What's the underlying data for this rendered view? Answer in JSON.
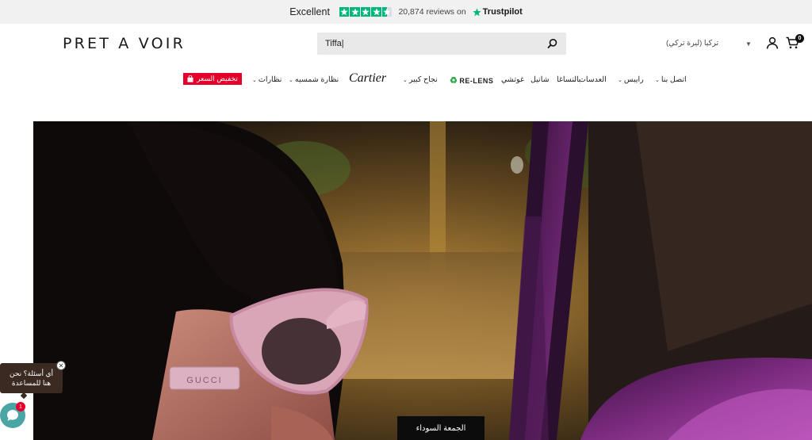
{
  "trustpilot": {
    "rating_text": "Excellent",
    "reviews": "20,874 reviews on",
    "brand": "Trustpilot",
    "star_color": "#00b67a",
    "rating_stars": 4.5
  },
  "header": {
    "logo": "PRET A VOIR",
    "search_value": "Tiffa|",
    "currency": "تركيا (ليرة تركي)",
    "cart_count": "0"
  },
  "nav": {
    "items": [
      {
        "label": "اتصل بنا"
      },
      {
        "label": "رايبس"
      },
      {
        "label": "العدسات"
      },
      {
        "label": "بالنساغا"
      },
      {
        "label": "شانيل"
      },
      {
        "label": "غوتشي"
      },
      {
        "label": "RE-LENS"
      },
      {
        "label": "نجاح كبير"
      },
      {
        "label": "Cartier"
      },
      {
        "label": "نظارة شمسيه"
      },
      {
        "label": "نظارات"
      }
    ],
    "sale_label": "تخفيض السعر",
    "sale_color": "#e4002b"
  },
  "hero": {
    "cta_label": "الجمعة السوداء"
  },
  "chat": {
    "bubble_text": "أي أسئلة؟ نحن هنا للمساعدة",
    "badge_count": "1",
    "launcher_color": "#4aa5a5"
  }
}
